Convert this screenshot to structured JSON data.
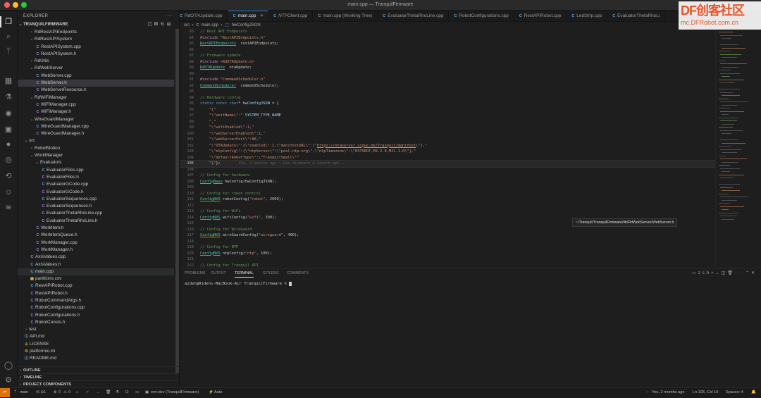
{
  "window": {
    "title": "main.cpp — TranquilFirmware"
  },
  "colors": {
    "accent": "#3b8eea",
    "remote": "#d9730d",
    "watermark": "#e8552b"
  },
  "activity_icons": [
    "files-icon",
    "search-icon",
    "source-control-icon",
    "extensions-icon",
    "testing-icon",
    "platformio-icon",
    "remote-explorer-icon",
    "github-icon",
    "gitlens-icon",
    "settings-sync-icon",
    "copilot-icon",
    "docker-icon",
    "account-icon",
    "gear-icon"
  ],
  "explorer": {
    "title": "EXPLORER",
    "folder": "TRANQUILFIRMWARE",
    "rows": [
      {
        "label": "RdRestAPIEndpoints",
        "type": "folder",
        "depth": 1,
        "open": false
      },
      {
        "label": "RdRestAPISystem",
        "type": "folder",
        "depth": 1,
        "open": true
      },
      {
        "label": "RestAPISystem.cpp",
        "type": "cpp",
        "depth": 2
      },
      {
        "label": "RestAPISystem.h",
        "type": "h",
        "depth": 2
      },
      {
        "label": "RdUtils",
        "type": "folder",
        "depth": 1,
        "open": false
      },
      {
        "label": "RdWebServer",
        "type": "folder",
        "depth": 1,
        "open": true
      },
      {
        "label": "WebServer.cpp",
        "type": "cpp",
        "depth": 2
      },
      {
        "label": "WebServer.h",
        "type": "h",
        "depth": 2,
        "selected": true
      },
      {
        "label": "WebServerResource.h",
        "type": "h",
        "depth": 2
      },
      {
        "label": "RdWiFiManager",
        "type": "folder",
        "depth": 1,
        "open": true
      },
      {
        "label": "WiFiManager.cpp",
        "type": "cpp",
        "depth": 2
      },
      {
        "label": "WiFiManager.h",
        "type": "h",
        "depth": 2
      },
      {
        "label": "WireGuardManager",
        "type": "folder",
        "depth": 1,
        "open": true
      },
      {
        "label": "WireGuardManager.cpp",
        "type": "cpp",
        "depth": 2
      },
      {
        "label": "WireGuardManager.h",
        "type": "h",
        "depth": 2
      },
      {
        "label": "src",
        "type": "folder",
        "depth": 0,
        "open": true
      },
      {
        "label": "RobotMotion",
        "type": "folder",
        "depth": 1,
        "open": false
      },
      {
        "label": "WorkManager",
        "type": "folder",
        "depth": 1,
        "open": true
      },
      {
        "label": "Evaluators",
        "type": "folder",
        "depth": 2,
        "open": true
      },
      {
        "label": "EvaluatorFiles.cpp",
        "type": "cpp",
        "depth": 3
      },
      {
        "label": "EvaluatorFiles.h",
        "type": "h",
        "depth": 3
      },
      {
        "label": "EvaluatorGCode.cpp",
        "type": "cpp",
        "depth": 3
      },
      {
        "label": "EvaluatorGCode.h",
        "type": "h",
        "depth": 3
      },
      {
        "label": "EvaluatorSequences.cpp",
        "type": "cpp",
        "depth": 3
      },
      {
        "label": "EvaluatorSequences.h",
        "type": "h",
        "depth": 3
      },
      {
        "label": "EvaluatorThetaRhoLine.cpp",
        "type": "cpp",
        "depth": 3
      },
      {
        "label": "EvaluatorThetaRhoLine.h",
        "type": "h",
        "depth": 3
      },
      {
        "label": "WorkItem.h",
        "type": "h",
        "depth": 2
      },
      {
        "label": "WorkItemQueue.h",
        "type": "h",
        "depth": 2
      },
      {
        "label": "WorkManager.cpp",
        "type": "cpp",
        "depth": 2
      },
      {
        "label": "WorkManager.h",
        "type": "h",
        "depth": 2
      },
      {
        "label": "AxisValues.cpp",
        "type": "cpp",
        "depth": 1
      },
      {
        "label": "AxisValues.h",
        "type": "h",
        "depth": 1
      },
      {
        "label": "main.cpp",
        "type": "cpp",
        "depth": 1,
        "active": true
      },
      {
        "label": "partitions.csv",
        "type": "csv",
        "depth": 1
      },
      {
        "label": "RestAPIRobot.cpp",
        "type": "cpp",
        "depth": 1
      },
      {
        "label": "RestAPIRobot.h",
        "type": "h",
        "depth": 1
      },
      {
        "label": "RobotCommandArgs.h",
        "type": "h",
        "depth": 1
      },
      {
        "label": "RobotConfigurations.cpp",
        "type": "cpp",
        "depth": 1
      },
      {
        "label": "RobotConfigurations.h",
        "type": "h",
        "depth": 1
      },
      {
        "label": "RobotConsts.h",
        "type": "h",
        "depth": 1
      },
      {
        "label": "test",
        "type": "folder",
        "depth": 0,
        "open": false
      },
      {
        "label": "API.md",
        "type": "md",
        "depth": 0
      },
      {
        "label": "LICENSE",
        "type": "lic",
        "depth": 0
      },
      {
        "label": "platformio.ini",
        "type": "ini",
        "depth": 0
      },
      {
        "label": "README.md",
        "type": "md",
        "depth": 0
      }
    ],
    "sections": [
      "OUTLINE",
      "TIMELINE",
      "PROJECT COMPONENTS"
    ]
  },
  "tabs": [
    {
      "label": "RdOTAUpdate.cpp",
      "type": "cpp"
    },
    {
      "label": "main.cpp",
      "type": "cpp",
      "active": true
    },
    {
      "label": "NTPClient.cpp",
      "type": "cpp",
      "italic": true
    },
    {
      "label": "main.cpp (Working Tree)",
      "type": "cpp"
    },
    {
      "label": "EvaluatorThetaRhoLine.cpp",
      "type": "cpp"
    },
    {
      "label": "RobotConfigurations.cpp",
      "type": "cpp"
    },
    {
      "label": "RestAPIRobot.cpp",
      "type": "cpp"
    },
    {
      "label": "LedStrip.cpp",
      "type": "cpp"
    },
    {
      "label": "EvaluatorThetaRhoLi",
      "type": "cpp"
    }
  ],
  "breadcrumb": [
    "src",
    "main.cpp",
    "hwConfigJSON"
  ],
  "code": {
    "current_line": 105,
    "lines": [
      {
        "n": "83",
        "tokens": [
          [
            "c",
            "// Rest API Endpoints"
          ]
        ]
      },
      {
        "n": "84",
        "tokens": [
          [
            "kw",
            "#include "
          ],
          [
            "s",
            "\"RestAPIEndpoints.h\""
          ]
        ]
      },
      {
        "n": "85",
        "tokens": [
          [
            "t",
            "RestAPIEndpoints"
          ],
          [
            "",
            "  restAPIEndpoints;"
          ]
        ]
      },
      {
        "n": "86",
        "tokens": []
      },
      {
        "n": "87",
        "tokens": [
          [
            "c",
            "// Firmware update"
          ]
        ]
      },
      {
        "n": "88",
        "tokens": [
          [
            "kw",
            "#include "
          ],
          [
            "s",
            "<RdOTAUpdate.h>"
          ]
        ]
      },
      {
        "n": "89",
        "tokens": [
          [
            "t",
            "RdOTAUpdate"
          ],
          [
            "",
            "  otaUpdate;"
          ]
        ]
      },
      {
        "n": "90",
        "tokens": []
      },
      {
        "n": "91",
        "tokens": [
          [
            "kw",
            "#include "
          ],
          [
            "s",
            "\"CommandScheduler.h\""
          ]
        ]
      },
      {
        "n": "92",
        "tokens": [
          [
            "t",
            "CommandScheduler"
          ],
          [
            "",
            "  commandScheduler;"
          ]
        ]
      },
      {
        "n": "93",
        "tokens": []
      },
      {
        "n": "94",
        "tokens": [
          [
            "c",
            "// Hardware config"
          ]
        ]
      },
      {
        "n": "95",
        "tokens": [
          [
            "k",
            "static const char"
          ],
          [
            "",
            "* "
          ],
          [
            "v",
            "hwConfigJSON"
          ],
          [
            "",
            " = {"
          ]
        ]
      },
      {
        "n": "96",
        "tokens": [
          [
            "s",
            "    \"{\""
          ]
        ]
      },
      {
        "n": "97",
        "tokens": [
          [
            "s",
            "    \"\\\"unitName\\\":\""
          ],
          [
            "",
            " "
          ],
          [
            "v",
            "SYSTEM_TYPE_NAME"
          ]
        ]
      },
      {
        "n": "98",
        "tokens": [
          [
            "s",
            "    \",\""
          ]
        ]
      },
      {
        "n": "99",
        "tokens": [
          [
            "s",
            "    \"\\\"wifiEnabled\\\":1,\""
          ]
        ]
      },
      {
        "n": "100",
        "tokens": [
          [
            "s",
            "    \"\\\"webServerEnabled\\\":1,\""
          ]
        ]
      },
      {
        "n": "101",
        "tokens": [
          [
            "s",
            "    \"\\\"webServerPort\\\":80,\""
          ]
        ]
      },
      {
        "n": "102",
        "tokens": [
          [
            "s",
            "    \"\\\"OTAUpdate\\\":{\\\"enabled\\\":1,\\\"manifestURL\\\":\\\""
          ],
          [
            "u",
            "https://otaserver.vigue.me/Tranquil/manifest"
          ],
          [
            "s",
            "\\\"},\""
          ]
        ]
      },
      {
        "n": "103",
        "tokens": [
          [
            "s",
            "    \"\\\"ntpConfig\\\":{\\\"ntpServer\\\":\\\"pool.ntp.org\\\",\\\"ntpTimezone\\\":\\\"EST5EDT,M3.2.0,M11.1.0\\\"},\""
          ]
        ]
      },
      {
        "n": "104",
        "tokens": [
          [
            "s",
            "    \"\\\"defaultRobotType\\\":\\\"TranquilSmall\\\"\""
          ]
        ]
      },
      {
        "n": "105",
        "tokens": [
          [
            "s",
            "    \"}\""
          ],
          [
            "",
            "};"
          ],
          [
            "g",
            "        You, 2 months ago • Use firmware & rework api …"
          ]
        ]
      },
      {
        "n": "106",
        "tokens": []
      },
      {
        "n": "107",
        "tokens": [
          [
            "c",
            "// Config for hardware"
          ]
        ]
      },
      {
        "n": "108",
        "tokens": [
          [
            "t",
            "ConfigBase"
          ],
          [
            "",
            " hwConfig(hwConfigJSON);"
          ]
        ]
      },
      {
        "n": "109",
        "tokens": []
      },
      {
        "n": "110",
        "tokens": [
          [
            "c",
            "// Config for robot control"
          ]
        ]
      },
      {
        "n": "111",
        "tokens": [
          [
            "t",
            "ConfigNVS"
          ],
          [
            "",
            " robotConfig("
          ],
          [
            "s",
            "\"robot\""
          ],
          [
            ", ",
            ""
          ],
          [
            "n",
            "2000"
          ],
          [
            "",
            ");"
          ]
        ]
      },
      {
        "n": "112",
        "tokens": []
      },
      {
        "n": "113",
        "tokens": [
          [
            "c",
            "// Config for WiFi"
          ]
        ]
      },
      {
        "n": "114",
        "tokens": [
          [
            "t",
            "ConfigNVS"
          ],
          [
            "",
            " wifiConfig("
          ],
          [
            "s",
            "\"wifi\""
          ],
          [
            ", ",
            ""
          ],
          [
            "n",
            "300"
          ],
          [
            "",
            ");"
          ]
        ]
      },
      {
        "n": "115",
        "tokens": []
      },
      {
        "n": "116",
        "tokens": [
          [
            "c",
            "// Config for WireGuard"
          ]
        ]
      },
      {
        "n": "117",
        "tokens": [
          [
            "t",
            "ConfigNVS"
          ],
          [
            "",
            " wireGuardConfig("
          ],
          [
            "s",
            "\"wireguard\""
          ],
          [
            ", ",
            ""
          ],
          [
            "n",
            "400"
          ],
          [
            "",
            ");"
          ]
        ]
      },
      {
        "n": "118",
        "tokens": []
      },
      {
        "n": "119",
        "tokens": [
          [
            "c",
            "// Config for NTP"
          ]
        ]
      },
      {
        "n": "120",
        "tokens": [
          [
            "t",
            "ConfigNVS"
          ],
          [
            "",
            " ntpConfig("
          ],
          [
            "s",
            "\"ntp\""
          ],
          [
            ", ",
            ""
          ],
          [
            "n",
            "100"
          ],
          [
            "",
            ");"
          ]
        ]
      },
      {
        "n": "121",
        "tokens": []
      },
      {
        "n": "122",
        "tokens": [
          [
            "c",
            "// Config for Tranquil API"
          ]
        ]
      },
      {
        "n": "123",
        "tokens": [
          [
            "t",
            "ConfigNVS"
          ],
          [
            "",
            " tranquilConfig("
          ],
          [
            "s",
            "\"tranquil\""
          ],
          [
            ", ",
            ""
          ],
          [
            "n",
            "400"
          ],
          [
            "",
            ");"
          ]
        ]
      }
    ]
  },
  "hover_path": "~/Tranquil/TranquilFirmware/lib/RdWebServer/WebServer.h",
  "panel": {
    "tabs": [
      "PROBLEMS",
      "OUTPUT",
      "TERMINAL",
      "GITLENS",
      "COMMENTS"
    ],
    "active": "TERMINAL",
    "shell": "zsh",
    "prompt": "aiden@Aidens-MacBook-Air TranquilFirmware %"
  },
  "status": {
    "branch": "main",
    "sync": "↑6 ⊖1",
    "errors": "0",
    "warnings": "0",
    "env": "env:dev (TranquilFirmware)",
    "auto": "Auto",
    "blame": "You, 2 months ago",
    "position": "Ln 105, Col 10",
    "spaces": "Spaces: 4"
  },
  "watermark": {
    "logo": "DF创客社区",
    "url": "mc.DFRobot.com.cn"
  }
}
